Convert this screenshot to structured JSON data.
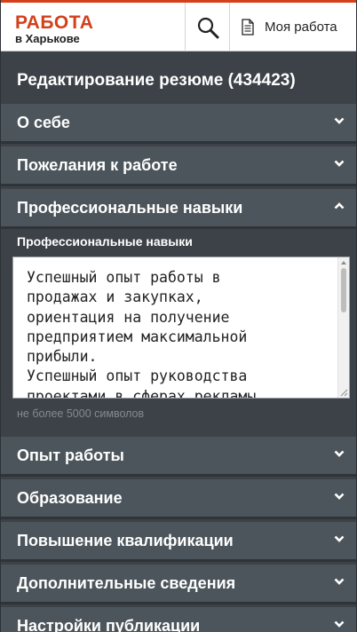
{
  "header": {
    "logo_top": "РАБОТА",
    "logo_bottom": "в Харькове",
    "my_work_label": "Моя работа"
  },
  "page_title": "Редактирование резюме (434423)",
  "sections": [
    {
      "label": "О себе",
      "expanded": false
    },
    {
      "label": "Пожелания к работе",
      "expanded": false
    },
    {
      "label": "Профессиональные навыки",
      "expanded": true
    },
    {
      "label": "Опыт работы",
      "expanded": false
    },
    {
      "label": "Образование",
      "expanded": false
    },
    {
      "label": "Повышение квалификации",
      "expanded": false
    },
    {
      "label": "Дополнительные сведения",
      "expanded": false
    },
    {
      "label": "Настройки публикации",
      "expanded": false
    }
  ],
  "skills_field": {
    "label": "Профессиональные навыки",
    "value": "Успешный опыт работы в\nпродажах и закупках,\nориентация на получение\nпредприятием максимальной\nприбыли.\nУспешный опыт руководства\nпроектами в сферах рекламы,",
    "hint": "не более 5000 символов"
  },
  "colors": {
    "brand": "#d3401a",
    "background": "#3c4247",
    "accordion": "#4c555b",
    "text": "#ffffff"
  },
  "icons": {
    "search": "search-icon",
    "document": "document-icon",
    "chevron_down": "chevron-down-icon",
    "chevron_up": "chevron-up-icon"
  }
}
